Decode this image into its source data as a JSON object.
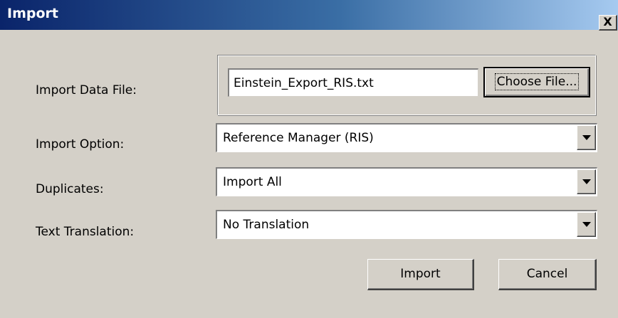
{
  "window": {
    "title": "Import",
    "close_label": "X"
  },
  "file": {
    "label": "Import Data File:",
    "value": "Einstein_Export_RIS.txt",
    "choose_label": "Choose File..."
  },
  "import_option": {
    "label": "Import Option:",
    "selected": "Reference Manager (RIS)"
  },
  "duplicates": {
    "label": "Duplicates:",
    "selected": "Import All"
  },
  "text_translation": {
    "label": "Text Translation:",
    "selected": "No Translation"
  },
  "actions": {
    "import_label": "Import",
    "cancel_label": "Cancel"
  },
  "icons": {
    "close": "close-icon",
    "dropdown": "chevron-down-icon"
  },
  "colors": {
    "dialog_face": "#d4d0c8",
    "titlebar_start": "#0a246a",
    "titlebar_end": "#a6caf0"
  }
}
